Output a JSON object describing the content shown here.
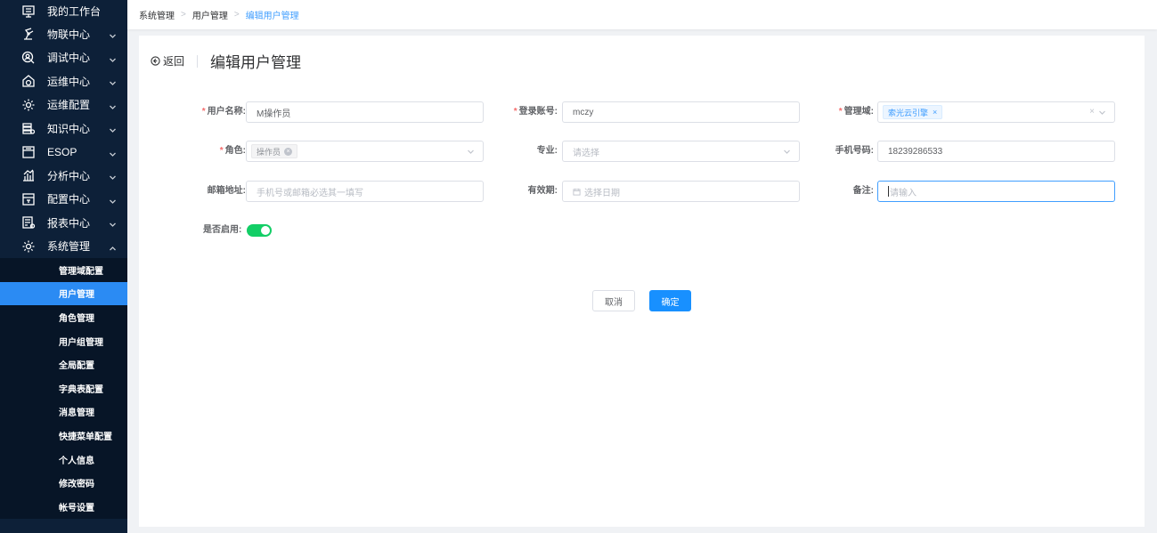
{
  "sidebar": {
    "items": [
      {
        "label": "我的工作台",
        "icon": "monitor-icon",
        "arrow": false
      },
      {
        "label": "物联中心",
        "icon": "robot-arm-icon",
        "arrow": true
      },
      {
        "label": "调试中心",
        "icon": "search-person-icon",
        "arrow": true
      },
      {
        "label": "运维中心",
        "icon": "house-gauge-icon",
        "arrow": true
      },
      {
        "label": "运维配置",
        "icon": "gear-icon",
        "arrow": true
      },
      {
        "label": "知识中心",
        "icon": "book-stack-icon",
        "arrow": true
      },
      {
        "label": "ESOP",
        "icon": "esop-doc-icon",
        "arrow": true
      },
      {
        "label": "分析中心",
        "icon": "bar-chart-icon",
        "arrow": true
      },
      {
        "label": "配置中心",
        "icon": "config-panel-icon",
        "arrow": true
      },
      {
        "label": "报表中心",
        "icon": "report-icon",
        "arrow": true
      },
      {
        "label": "系统管理",
        "icon": "gear-icon",
        "arrow": true,
        "expanded": true
      }
    ],
    "sub_items": [
      {
        "label": "管理域配置",
        "active": false
      },
      {
        "label": "用户管理",
        "active": true
      },
      {
        "label": "角色管理",
        "active": false
      },
      {
        "label": "用户组管理",
        "active": false
      },
      {
        "label": "全局配置",
        "active": false
      },
      {
        "label": "字典表配置",
        "active": false
      },
      {
        "label": "消息管理",
        "active": false
      },
      {
        "label": "快捷菜单配置",
        "active": false
      },
      {
        "label": "个人信息",
        "active": false
      },
      {
        "label": "修改密码",
        "active": false
      },
      {
        "label": "帐号设置",
        "active": false
      }
    ]
  },
  "breadcrumb": [
    "系统管理",
    "用户管理",
    "编辑用户管理"
  ],
  "page": {
    "back_label": "返回",
    "title": "编辑用户管理"
  },
  "form": {
    "username": {
      "label": "用户名称:",
      "value": "M操作员",
      "required": true
    },
    "account": {
      "label": "登录账号:",
      "value": "mczy",
      "required": true
    },
    "domain": {
      "label": "管理域:",
      "tag": "索光云引擎",
      "tag_close": "×",
      "clear": "×",
      "required": true
    },
    "role": {
      "label": "角色:",
      "tag": "操作员",
      "tag_close": "×",
      "required": true
    },
    "major": {
      "label": "专业:",
      "placeholder": "请选择"
    },
    "phone": {
      "label": "手机号码:",
      "value": "18239286533"
    },
    "email": {
      "label": "邮箱地址:",
      "placeholder": "手机号或邮箱必选其一填写"
    },
    "expiry": {
      "label": "有效期:",
      "placeholder": "选择日期"
    },
    "remark": {
      "label": "备注:",
      "placeholder": "请输入"
    },
    "enabled": {
      "label": "是否启用:",
      "value": true
    }
  },
  "buttons": {
    "cancel": "取消",
    "confirm": "确定"
  },
  "colors": {
    "sidebar_bg": "#0d2038",
    "active": "#2b8bf3",
    "primary": "#1890ff",
    "switch_on": "#13ce66",
    "required": "#f56c6c"
  }
}
